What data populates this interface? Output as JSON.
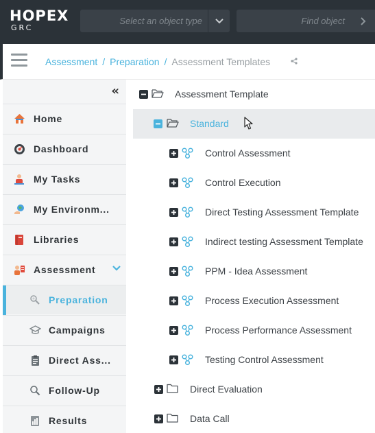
{
  "app": {
    "logo": "HOPEX",
    "logo_sub": "GRC",
    "type_select_placeholder": "Select an object type",
    "find_placeholder": "Find object"
  },
  "breadcrumb": {
    "items": [
      "Assessment",
      "Preparation"
    ],
    "current": "Assessment Templates",
    "separator": "/"
  },
  "sidebar": {
    "items": [
      {
        "label": "Home",
        "icon": "home-icon"
      },
      {
        "label": "Dashboard",
        "icon": "dashboard-icon"
      },
      {
        "label": "My Tasks",
        "icon": "tasks-icon"
      },
      {
        "label": "My Environm...",
        "icon": "environment-icon"
      },
      {
        "label": "Libraries",
        "icon": "library-book-icon"
      },
      {
        "label": "Assessment",
        "icon": "assessment-icon",
        "expanded": true
      }
    ],
    "sub_items": [
      {
        "label": "Preparation",
        "icon": "preparation-icon",
        "active": true
      },
      {
        "label": "Campaigns",
        "icon": "campaigns-icon"
      },
      {
        "label": "Direct Ass...",
        "icon": "clipboard-icon"
      },
      {
        "label": "Follow-Up",
        "icon": "search-icon"
      },
      {
        "label": "Results",
        "icon": "results-icon"
      }
    ]
  },
  "tree": {
    "root": "Assessment Template",
    "standard": "Standard",
    "templates": [
      "Control Assessment",
      "Control Execution",
      "Direct Testing Assessment Template",
      "Indirect testing Assessment Template",
      "PPM - Idea Assessment",
      "Process Execution Assessment",
      "Process Performance Assessment",
      "Testing Control Assessment"
    ],
    "folders": [
      "Direct Evaluation",
      "Data Call"
    ]
  },
  "colors": {
    "accent": "#4ab3dd",
    "topbar": "#2b3238",
    "sidebar_bg": "#f4f5f6",
    "selected_row": "#e9ebed"
  }
}
